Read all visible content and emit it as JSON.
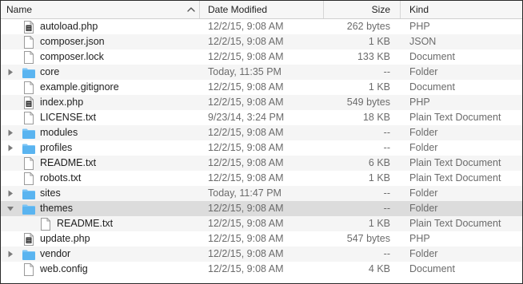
{
  "columns": {
    "name": "Name",
    "date": "Date Modified",
    "size": "Size",
    "kind": "Kind"
  },
  "icons": {
    "sort": "chevron-up-icon",
    "folder": "folder-icon",
    "document": "document-icon",
    "executable": "executable-document-icon",
    "expand_closed": "disclosure-triangle-right-icon",
    "expand_open": "disclosure-triangle-down-icon"
  },
  "colors": {
    "folder": "#5ab4f0",
    "folder_tab": "#7cc4f4",
    "selected_row": "#dcdcdc",
    "alt_row": "#f5f5f5"
  },
  "files": [
    {
      "name": "autoload.php",
      "date": "12/2/15, 9:08 AM",
      "size": "262 bytes",
      "kind": "PHP",
      "icon": "executable",
      "level": 0
    },
    {
      "name": "composer.json",
      "date": "12/2/15, 9:08 AM",
      "size": "1 KB",
      "kind": "JSON",
      "icon": "document",
      "level": 0
    },
    {
      "name": "composer.lock",
      "date": "12/2/15, 9:08 AM",
      "size": "133 KB",
      "kind": "Document",
      "icon": "document",
      "level": 0
    },
    {
      "name": "core",
      "date": "Today, 11:35 PM",
      "size": "--",
      "kind": "Folder",
      "icon": "folder",
      "level": 0,
      "expand": "closed"
    },
    {
      "name": "example.gitignore",
      "date": "12/2/15, 9:08 AM",
      "size": "1 KB",
      "kind": "Document",
      "icon": "document",
      "level": 0
    },
    {
      "name": "index.php",
      "date": "12/2/15, 9:08 AM",
      "size": "549 bytes",
      "kind": "PHP",
      "icon": "executable",
      "level": 0
    },
    {
      "name": "LICENSE.txt",
      "date": "9/23/14, 3:24 PM",
      "size": "18 KB",
      "kind": "Plain Text Document",
      "icon": "document",
      "level": 0
    },
    {
      "name": "modules",
      "date": "12/2/15, 9:08 AM",
      "size": "--",
      "kind": "Folder",
      "icon": "folder",
      "level": 0,
      "expand": "closed"
    },
    {
      "name": "profiles",
      "date": "12/2/15, 9:08 AM",
      "size": "--",
      "kind": "Folder",
      "icon": "folder",
      "level": 0,
      "expand": "closed"
    },
    {
      "name": "README.txt",
      "date": "12/2/15, 9:08 AM",
      "size": "6 KB",
      "kind": "Plain Text Document",
      "icon": "document",
      "level": 0
    },
    {
      "name": "robots.txt",
      "date": "12/2/15, 9:08 AM",
      "size": "1 KB",
      "kind": "Plain Text Document",
      "icon": "document",
      "level": 0
    },
    {
      "name": "sites",
      "date": "Today, 11:47 PM",
      "size": "--",
      "kind": "Folder",
      "icon": "folder",
      "level": 0,
      "expand": "closed"
    },
    {
      "name": "themes",
      "date": "12/2/15, 9:08 AM",
      "size": "--",
      "kind": "Folder",
      "icon": "folder",
      "level": 0,
      "expand": "open",
      "selected": true
    },
    {
      "name": "README.txt",
      "date": "12/2/15, 9:08 AM",
      "size": "1 KB",
      "kind": "Plain Text Document",
      "icon": "document",
      "level": 1
    },
    {
      "name": "update.php",
      "date": "12/2/15, 9:08 AM",
      "size": "547 bytes",
      "kind": "PHP",
      "icon": "executable",
      "level": 0
    },
    {
      "name": "vendor",
      "date": "12/2/15, 9:08 AM",
      "size": "--",
      "kind": "Folder",
      "icon": "folder",
      "level": 0,
      "expand": "closed"
    },
    {
      "name": "web.config",
      "date": "12/2/15, 9:08 AM",
      "size": "4 KB",
      "kind": "Document",
      "icon": "document",
      "level": 0
    }
  ]
}
